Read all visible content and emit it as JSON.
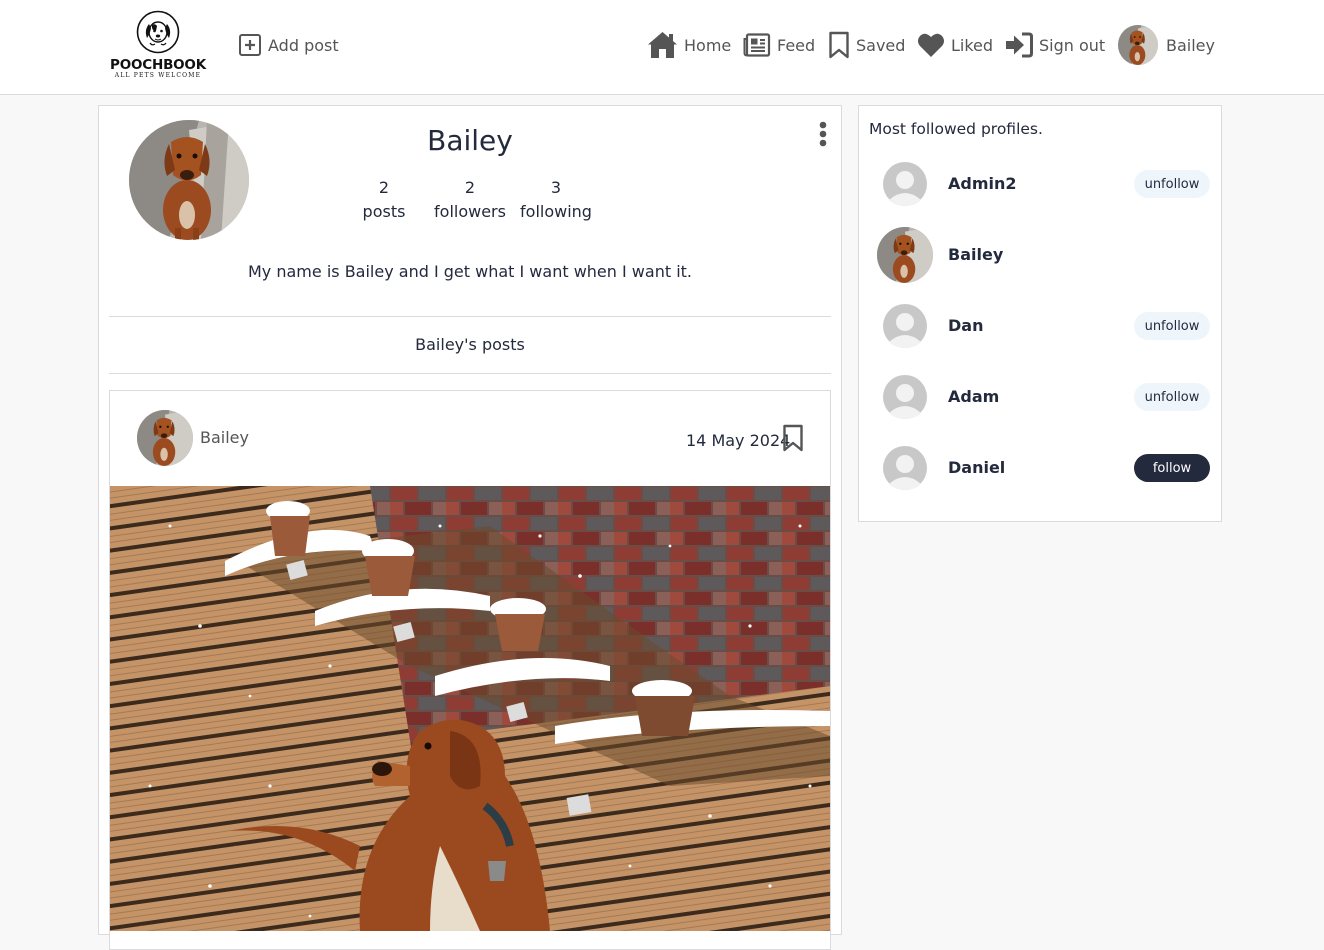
{
  "brand": {
    "name": "POOCHBOOK",
    "tagline": "ALL PETS WELCOME"
  },
  "nav": {
    "add_post": "Add post",
    "home": "Home",
    "feed": "Feed",
    "saved": "Saved",
    "liked": "Liked",
    "sign_out": "Sign out",
    "profile": "Bailey"
  },
  "profile": {
    "name": "Bailey",
    "stats": [
      {
        "value": "2",
        "label": "posts"
      },
      {
        "value": "2",
        "label": "followers"
      },
      {
        "value": "3",
        "label": "following"
      }
    ],
    "bio": "My name is Bailey and I get what I want when I want it.",
    "posts_heading": "Bailey's posts"
  },
  "post": {
    "author": "Bailey",
    "date": "14 May 2024"
  },
  "sidebar": {
    "title": "Most followed profiles.",
    "profiles": [
      {
        "name": "Admin2",
        "action": "unfollow",
        "avatar": "default"
      },
      {
        "name": "Bailey",
        "action": "",
        "avatar": "dog"
      },
      {
        "name": "Dan",
        "action": "unfollow",
        "avatar": "default"
      },
      {
        "name": "Adam",
        "action": "unfollow",
        "avatar": "default"
      },
      {
        "name": "Daniel",
        "action": "follow",
        "avatar": "default"
      }
    ]
  },
  "colors": {
    "primary": "#242a3d",
    "muted_text": "#555555",
    "unfollow_bg": "#eef6fc",
    "border": "#dadadf",
    "page_bg": "#f8f8f8"
  },
  "icons": [
    "add-post-icon",
    "home-icon",
    "feed-icon",
    "bookmark-icon",
    "heart-icon",
    "sign-out-icon",
    "more-options-icon",
    "default-avatar-icon"
  ]
}
